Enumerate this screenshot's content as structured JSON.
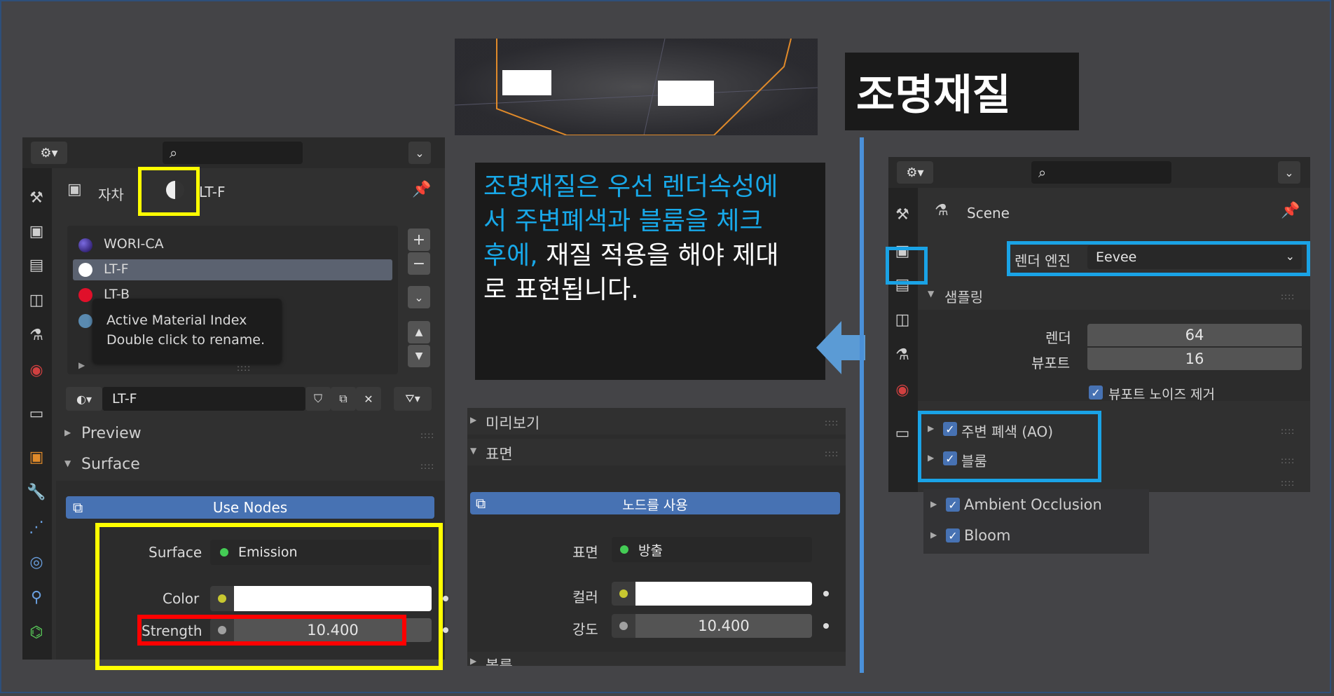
{
  "title": "조명재질",
  "description_text": {
    "highlight": "조명재질은 우선 렌더속성에서 주변폐색과 블룸을 체크후에,",
    "line1": "조명재질은 우선  렌더속성에",
    "line2": "서 주변폐색과 블룸을 체크",
    "line3_highlight": "후에,",
    "line3_rest": " 재질 적용을 해야 제대",
    "line4": "로 표현됩니다."
  },
  "left_panel": {
    "object_label": "자차",
    "material_name_top": "LT-F",
    "materials": [
      {
        "name": "WORI-CA",
        "color": "#3a2a9a"
      },
      {
        "name": "LT-F",
        "color": "#ffffff"
      },
      {
        "name": "LT-B",
        "color": "#e0102a"
      },
      {
        "name": "",
        "color": "#5a8ab0"
      }
    ],
    "tooltip_line1": "Active Material Index",
    "tooltip_line2": "Double click to rename.",
    "material_field": "LT-F",
    "sections": {
      "preview": "Preview",
      "surface": "Surface"
    },
    "use_nodes": "Use Nodes",
    "surface_label": "Surface",
    "surface_value": "Emission",
    "color_label": "Color",
    "strength_label": "Strength",
    "strength_value": "10.400"
  },
  "middle_panel": {
    "sections": {
      "preview": "미리보기",
      "surface": "표면",
      "bottom": "볼륨"
    },
    "use_nodes": "노드를 사용",
    "surface_label": "표면",
    "surface_value": "방출",
    "color_label": "컬러",
    "strength_label": "강도",
    "strength_value": "10.400"
  },
  "right_panel": {
    "scene_label": "Scene",
    "render_engine_label": "렌더 엔진",
    "render_engine_value": "Eevee",
    "sampling_label": "샘플링",
    "render_label": "렌더",
    "render_value": "64",
    "viewport_label": "뷰포트",
    "viewport_value": "16",
    "viewport_denoise": "뷰포트 노이즈 제거",
    "ao_label": "주변 폐색 (AO)",
    "bloom_label": "블룸",
    "ao_en": "Ambient Occlusion",
    "bloom_en": "Bloom"
  },
  "colors": {
    "yellow_highlight": "#ffff00",
    "red_highlight": "#ff0000",
    "blue_highlight": "#1aa3e6",
    "accent_blue": "#4772b3",
    "cyan_text": "#18a8e8"
  }
}
